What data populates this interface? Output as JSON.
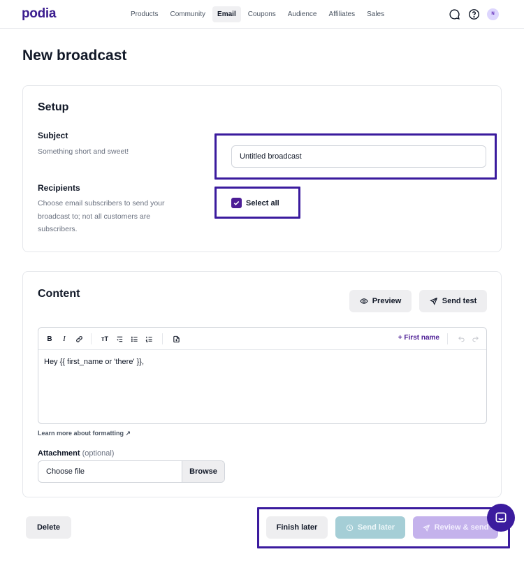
{
  "brand": {
    "logo": "podia",
    "accent": "#3b1d8f",
    "highlight_color": "#3b1b9e"
  },
  "nav": {
    "items": [
      {
        "label": "Products",
        "active": false
      },
      {
        "label": "Community",
        "active": false
      },
      {
        "label": "Email",
        "active": true
      },
      {
        "label": "Coupons",
        "active": false
      },
      {
        "label": "Audience",
        "active": false
      },
      {
        "label": "Affiliates",
        "active": false
      },
      {
        "label": "Sales",
        "active": false
      }
    ],
    "icons": [
      "chat-icon",
      "help-icon"
    ],
    "avatar_initial": "N"
  },
  "page": {
    "title": "New broadcast"
  },
  "setup": {
    "title": "Setup",
    "subject": {
      "label": "Subject",
      "help": "Something short and sweet!",
      "value": "Untitled broadcast"
    },
    "recipients": {
      "label": "Recipients",
      "help": "Choose email subscribers to send your broadcast to; not all customers are subscribers.",
      "select_all_label": "Select all",
      "select_all_checked": true
    }
  },
  "content": {
    "title": "Content",
    "preview_label": "Preview",
    "send_test_label": "Send test",
    "toolbar": {
      "bold": "B",
      "italic": "I",
      "text_size": "тT",
      "first_name_label": "+ First name"
    },
    "body": "Hey {{ first_name or 'there' }},",
    "learn_more": "Learn more about formatting ↗",
    "attachment": {
      "label": "Attachment",
      "optional": "(optional)",
      "placeholder": "Choose file",
      "browse_label": "Browse"
    }
  },
  "footer": {
    "delete_label": "Delete",
    "finish_later_label": "Finish later",
    "send_later_label": "Send later",
    "review_send_label": "Review & send"
  }
}
